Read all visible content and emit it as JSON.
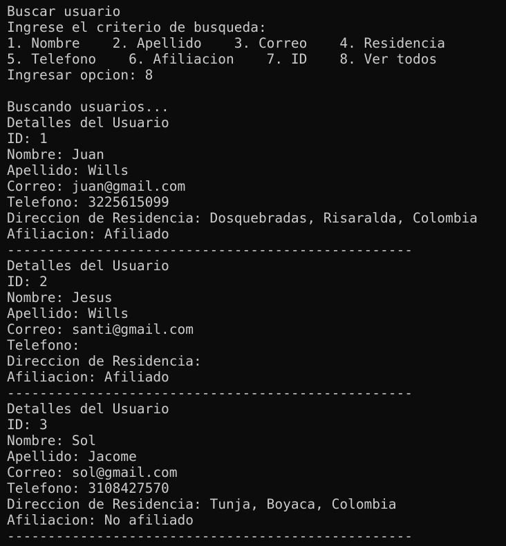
{
  "terminal": {
    "colors": {
      "background": "#0c0c0c",
      "foreground": "#cccccc"
    },
    "lines": [
      "Buscar usuario",
      "Ingrese el criterio de busqueda:",
      "1. Nombre    2. Apellido    3. Correo    4. Residencia",
      "5. Telefono    6. Afiliacion    7. ID    8. Ver todos",
      "Ingresar opcion: 8",
      "",
      "Buscando usuarios...",
      "Detalles del Usuario",
      "ID: 1",
      "Nombre: Juan",
      "Apellido: Wills",
      "Correo: juan@gmail.com",
      "Telefono: 3225615099",
      "Direccion de Residencia: Dosquebradas, Risaralda, Colombia",
      "Afiliacion: Afiliado",
      "--------------------------------------------------",
      "Detalles del Usuario",
      "ID: 2",
      "Nombre: Jesus",
      "Apellido: Wills",
      "Correo: santi@gmail.com",
      "Telefono:",
      "Direccion de Residencia:",
      "Afiliacion: Afiliado",
      "--------------------------------------------------",
      "Detalles del Usuario",
      "ID: 3",
      "Nombre: Sol",
      "Apellido: Jacome",
      "Correo: sol@gmail.com",
      "Telefono: 3108427570",
      "Direccion de Residencia: Tunja, Boyaca, Colombia",
      "Afiliacion: No afiliado",
      "--------------------------------------------------"
    ]
  }
}
